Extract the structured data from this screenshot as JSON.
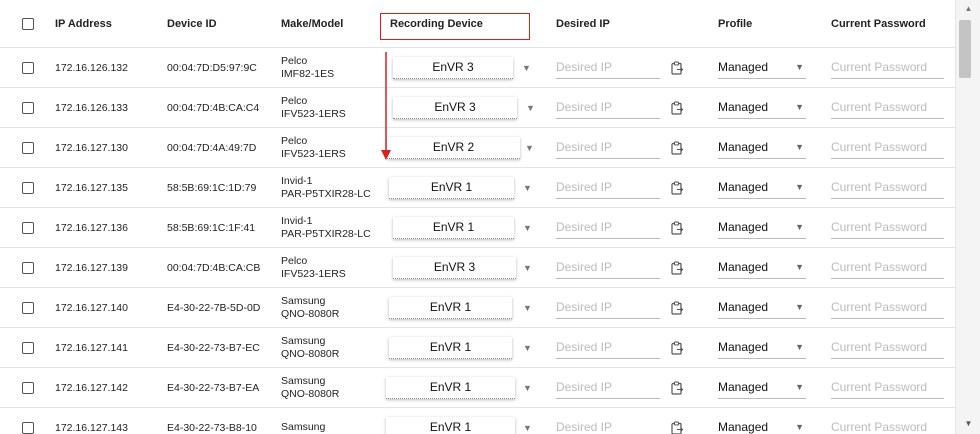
{
  "headers": {
    "ip": "IP Address",
    "device_id": "Device ID",
    "make_model": "Make/Model",
    "recording_device": "Recording Device",
    "desired_ip": "Desired IP",
    "profile": "Profile",
    "current_password": "Current Password"
  },
  "placeholders": {
    "desired_ip": "Desired IP",
    "current_password": "Current Password"
  },
  "icons": {
    "paste": "clipboard-paste-icon",
    "dropdown": "caret-down-icon",
    "scroll_up": "scroll-up-icon",
    "scroll_down": "scroll-down-icon"
  },
  "colors": {
    "highlight": "#d92020",
    "accent_text": "#111111",
    "placeholder": "#bbbbbb"
  },
  "rows": [
    {
      "ip": "172.16.126.132",
      "device_id": "00:04:7D:D5:97:9C",
      "make": "Pelco",
      "model": "IMF82-1ES",
      "recorder": "EnVR 3",
      "profile": "Managed"
    },
    {
      "ip": "172.16.126.133",
      "device_id": "00:04:7D:4B:CA:C4",
      "make": "Pelco",
      "model": "IFV523-1ERS",
      "recorder": "EnVR 3",
      "profile": "Managed"
    },
    {
      "ip": "172.16.127.130",
      "device_id": "00:04:7D:4A:49:7D",
      "make": "Pelco",
      "model": "IFV523-1ERS",
      "recorder": "EnVR 2",
      "profile": "Managed"
    },
    {
      "ip": "172.16.127.135",
      "device_id": "58:5B:69:1C:1D:79",
      "make": "Invid-1",
      "model": "PAR-P5TXIR28-LC",
      "recorder": "EnVR 1",
      "profile": "Managed"
    },
    {
      "ip": "172.16.127.136",
      "device_id": "58:5B:69:1C:1F:41",
      "make": "Invid-1",
      "model": "PAR-P5TXIR28-LC",
      "recorder": "EnVR 1",
      "profile": "Managed"
    },
    {
      "ip": "172.16.127.139",
      "device_id": "00:04:7D:4B:CA:CB",
      "make": "Pelco",
      "model": "IFV523-1ERS",
      "recorder": "EnVR 3",
      "profile": "Managed"
    },
    {
      "ip": "172.16.127.140",
      "device_id": "E4-30-22-7B-5D-0D",
      "make": "Samsung",
      "model": "QNO-8080R",
      "recorder": "EnVR 1",
      "profile": "Managed"
    },
    {
      "ip": "172.16.127.141",
      "device_id": "E4-30-22-73-B7-EC",
      "make": "Samsung",
      "model": "QNO-8080R",
      "recorder": "EnVR 1",
      "profile": "Managed"
    },
    {
      "ip": "172.16.127.142",
      "device_id": "E4-30-22-73-B7-EA",
      "make": "Samsung",
      "model": "QNO-8080R",
      "recorder": "EnVR 1",
      "profile": "Managed"
    },
    {
      "ip": "172.16.127.143",
      "device_id": "E4-30-22-73-B8-10",
      "make": "Samsung",
      "model": "",
      "recorder": "EnVR 1",
      "profile": "Managed"
    }
  ]
}
